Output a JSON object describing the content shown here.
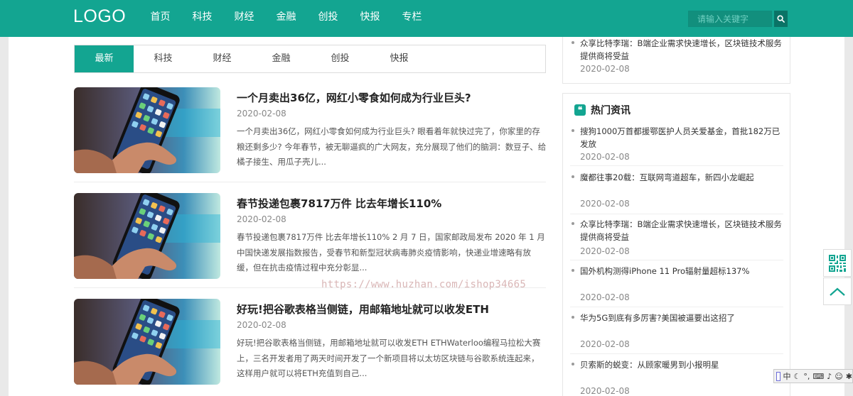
{
  "header": {
    "logo": "LOGO",
    "nav": [
      "首页",
      "科技",
      "财经",
      "金融",
      "创投",
      "快报",
      "专栏"
    ],
    "search_placeholder": "请输入关键字"
  },
  "tabs": [
    "最新",
    "科技",
    "财经",
    "金融",
    "创投",
    "快报"
  ],
  "articles": [
    {
      "title": "一个月卖出36亿，网红小零食如何成为行业巨头?",
      "date": "2020-02-08",
      "summary": "一个月卖出36亿，网红小零食如何成为行业巨头? 眼看着年就快过完了，你家里的存粮还剩多少? 今年春节，被无聊逼疯的广大网友，充分展现了他们的脑洞：数豆子、给橘子接生、用瓜子壳儿..."
    },
    {
      "title": "春节投递包裹7817万件 比去年增长110%",
      "date": "2020-02-08",
      "summary": "春节投递包裹7817万件 比去年增长110% 2 月 7 日，国家邮政局发布 2020 年 1 月中国快递发展指数报告，受春节和新型冠状病毒肺炎疫情影响，快递业增速略有放缓，但在抗击疫情过程中充分彰显..."
    },
    {
      "title": "好玩!把谷歌表格当侧链，用邮箱地址就可以收发ETH",
      "date": "2020-02-08",
      "summary": "好玩!把谷歌表格当侧链，用邮箱地址就可以收发ETH ETHWaterloo编程马拉松大赛上，三名开发者用了两天时间开发了一个新项目将以太坊区块链与谷歌系统连起来，这样用户就可以将ETH充值到自己..."
    }
  ],
  "watermark": "https://www.huzhan.com/ishop34665",
  "sidebar_top": {
    "title": "众享比特李瑞：B端企业需求快速增长，区块链技术服务提供商将受益",
    "date": "2020-02-08"
  },
  "hot_news": {
    "heading": "热门资讯",
    "items": [
      {
        "title": "搜狗1000万首都援鄂医护人员关爱基金，首批182万已发放",
        "date": "2020-02-08"
      },
      {
        "title": "魔都往事20载：互联网弯道超车，新四小龙崛起",
        "date": "2020-02-08"
      },
      {
        "title": "众享比特李瑞：B端企业需求快速增长，区块链技术服务提供商将受益",
        "date": "2020-02-08"
      },
      {
        "title": "国外机构测得iPhone 11 Pro辐射量超标137%",
        "date": "2020-02-08"
      },
      {
        "title": "华为5G到底有多厉害?美国被逼要出这招了",
        "date": "2020-02-08"
      },
      {
        "title": "贝索斯的蜕变：从顾家暖男到小报明星",
        "date": "2020-02-08"
      }
    ]
  },
  "ime": {
    "lang": "中"
  },
  "colors": {
    "accent": "#13a591"
  }
}
